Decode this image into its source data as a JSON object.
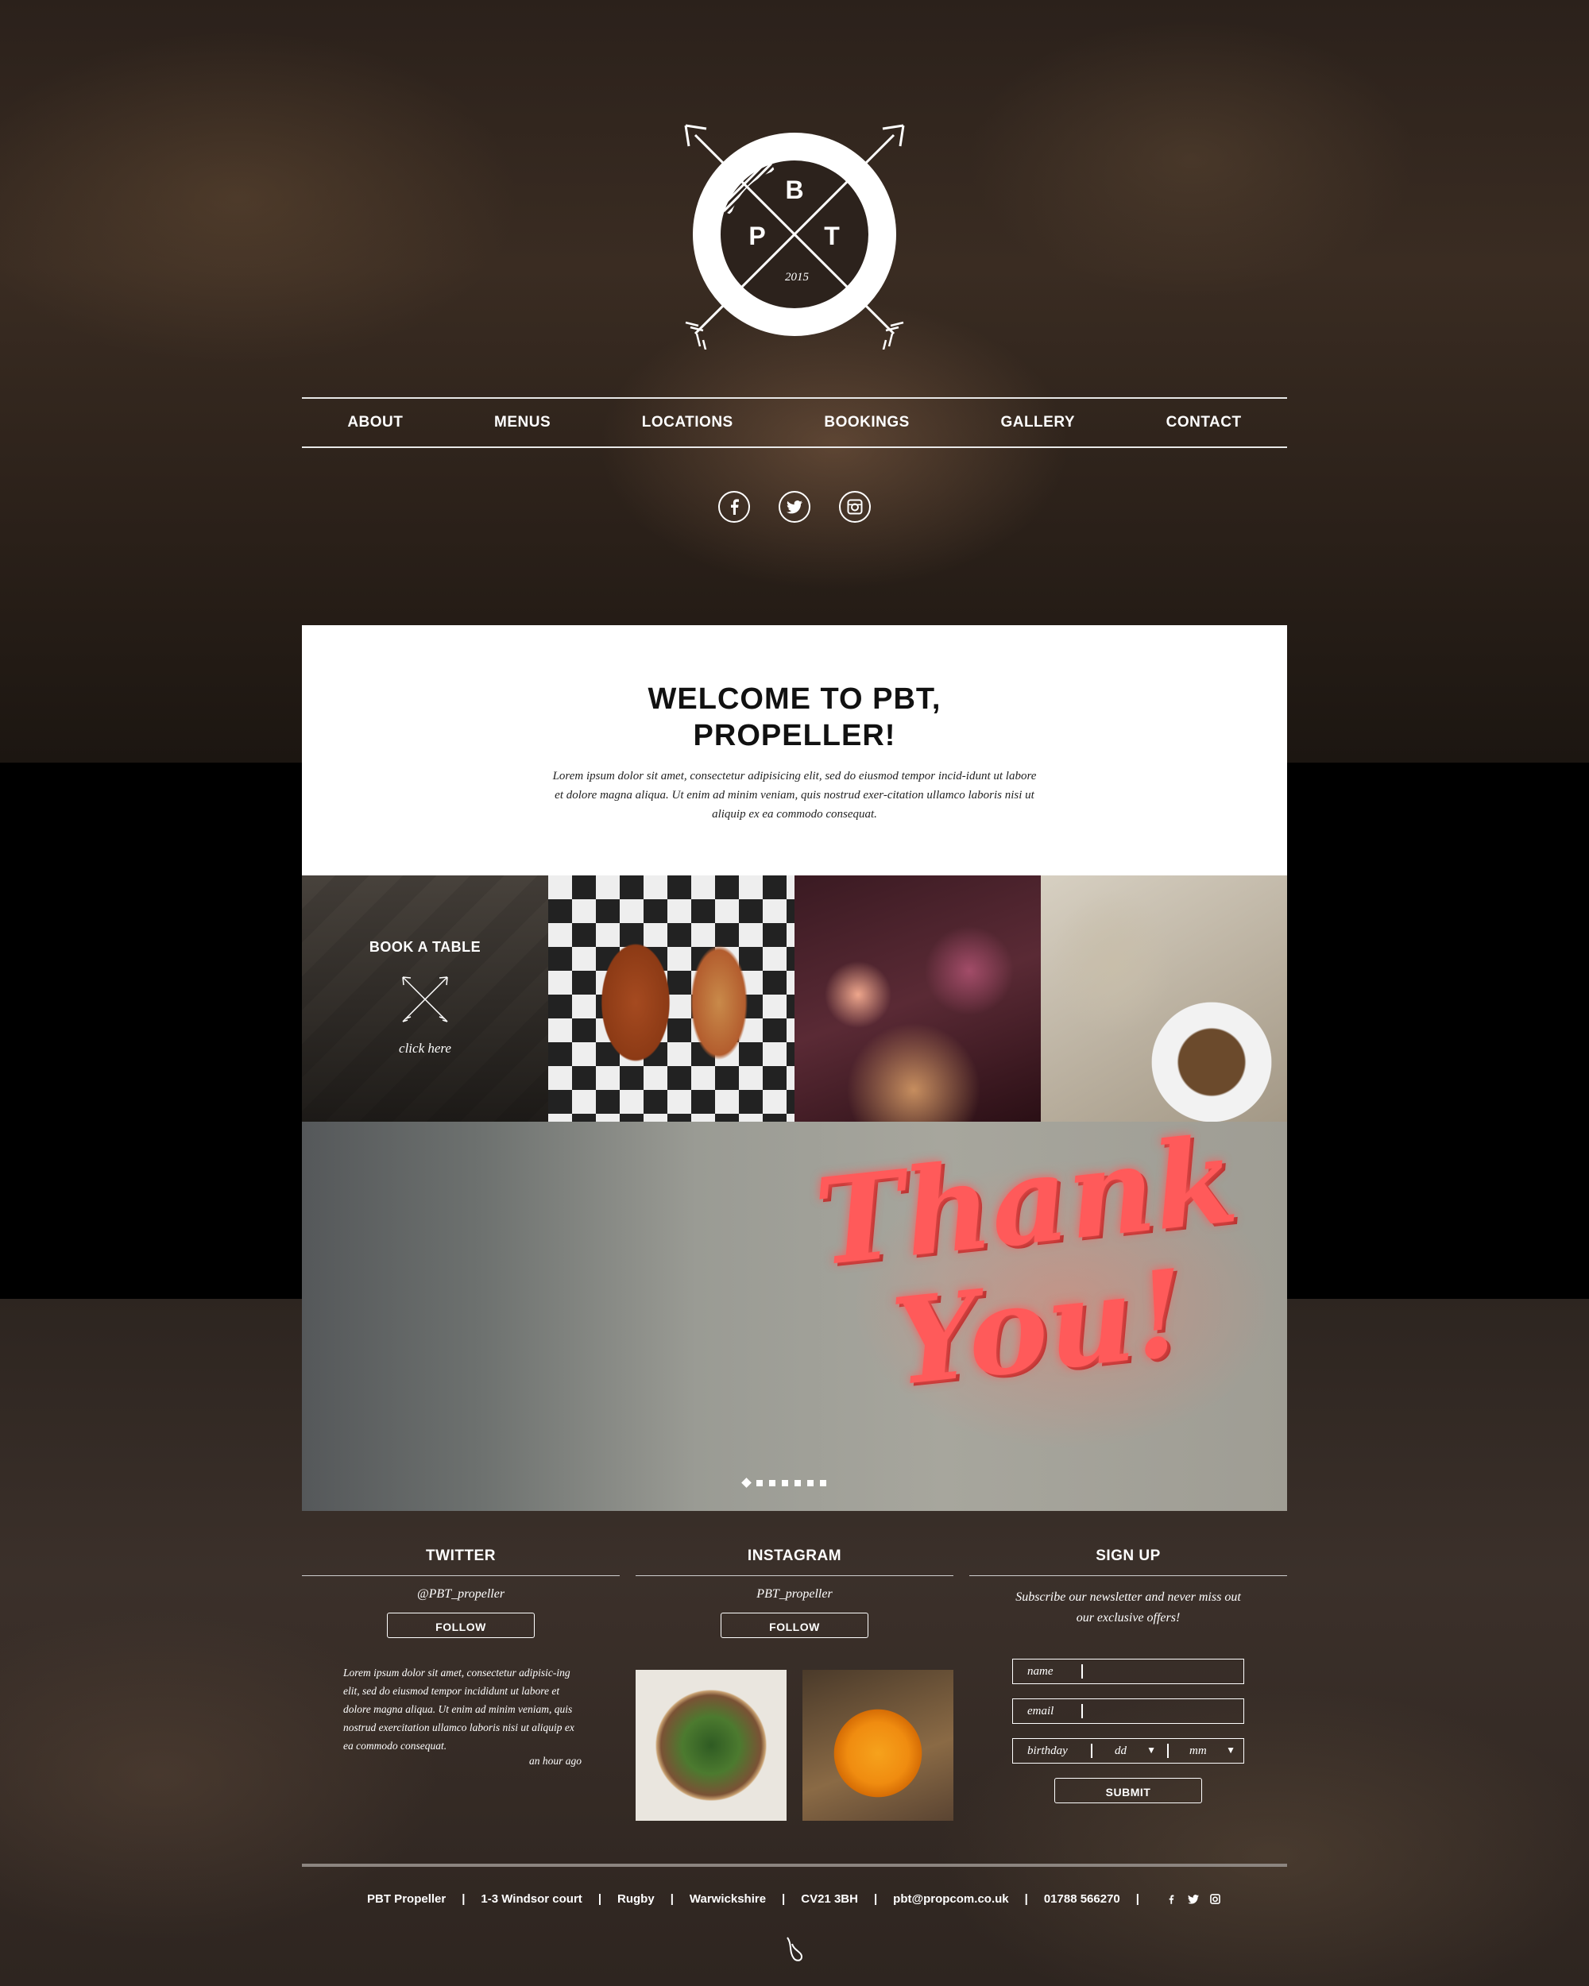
{
  "logo": {
    "letters": [
      "B",
      "P",
      "T"
    ],
    "year": "2015"
  },
  "nav": [
    "ABOUT",
    "MENUS",
    "LOCATIONS",
    "BOOKINGS",
    "GALLERY",
    "CONTACT"
  ],
  "social_icons": [
    "facebook-icon",
    "twitter-icon",
    "instagram-icon"
  ],
  "welcome": {
    "title_line1": "WELCOME TO PBT,",
    "title_line2": "PROPELLER!",
    "body": "Lorem ipsum dolor sit amet, consectetur adipisicing elit, sed do eiusmod tempor incid-idunt ut labore et dolore magna aliqua. Ut enim ad minim veniam, quis nostrud exer-citation ullamco laboris nisi ut aliquip ex ea commodo consequat."
  },
  "book": {
    "label": "BOOK A TABLE",
    "cta": "click here"
  },
  "banner": {
    "line1": "Thank",
    "line2": "You!",
    "slides": 7,
    "active_slide": 1
  },
  "twitter": {
    "heading": "TWITTER",
    "handle": "@PBT_propeller",
    "follow": "FOLLOW",
    "tweet": "Lorem ipsum dolor sit amet, consectetur adipisic-ing elit, sed do eiusmod tempor incididunt ut labore et dolore magna aliqua. Ut enim ad minim veniam, quis nostrud exercitation ullamco laboris nisi ut aliquip ex ea commodo consequat.",
    "time": "an hour ago"
  },
  "instagram": {
    "heading": "INSTAGRAM",
    "handle": "PBT_propeller",
    "follow": "FOLLOW"
  },
  "signup": {
    "heading": "SIGN UP",
    "text_line1": "Subscribe our newsletter and never miss out",
    "text_line2": "our exclusive offers!",
    "name_label": "name",
    "email_label": "email",
    "birthday_label": "birthday",
    "dd": "dd",
    "mm": "mm",
    "submit": "SUBMIT"
  },
  "footer": {
    "name": "PBT Propeller",
    "address": "1-3 Windsor court",
    "town": "Rugby",
    "county": "Warwickshire",
    "postcode": "CV21 3BH",
    "email": "pbt@propcom.co.uk",
    "phone": "01788 566270"
  }
}
